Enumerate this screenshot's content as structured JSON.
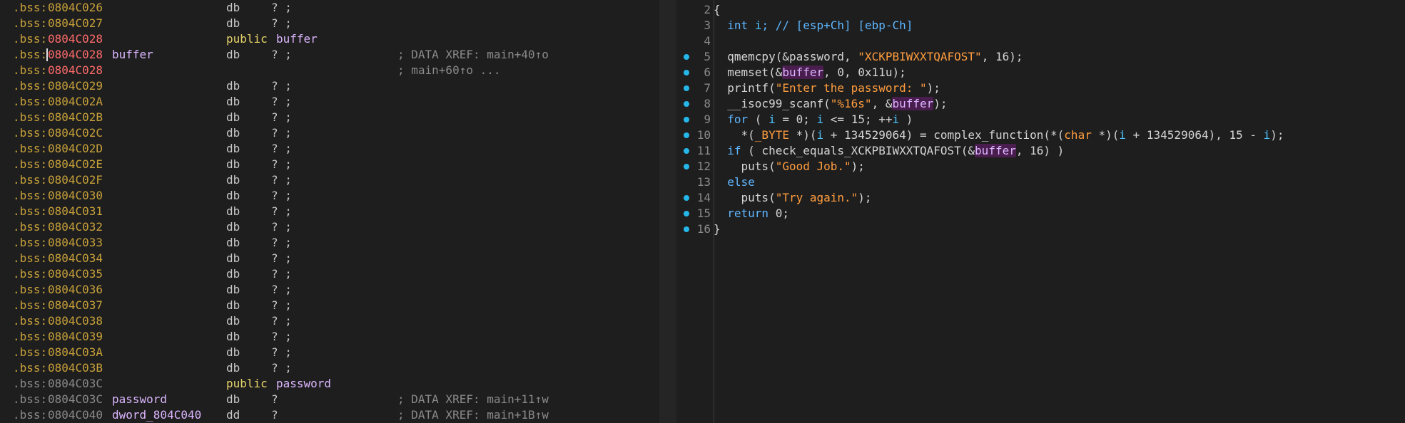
{
  "ida_view": {
    "lines": [
      {
        "seg": ".bss:",
        "addr": "0804C026",
        "label": "",
        "mnem": "db",
        "operand": "? ;",
        "comment": "",
        "addr_style": "normal"
      },
      {
        "seg": ".bss:",
        "addr": "0804C027",
        "label": "",
        "mnem": "db",
        "operand": "? ;",
        "comment": "",
        "addr_style": "normal"
      },
      {
        "seg": ".bss:",
        "addr": "0804C028",
        "label": "",
        "mnem": "public",
        "operand": "buffer",
        "comment": "",
        "addr_style": "red"
      },
      {
        "seg": ".bss:",
        "addr": "0804C028",
        "label": "buffer",
        "mnem": "db",
        "operand": "? ;",
        "comment": "; DATA XREF: main+40↑o",
        "addr_style": "red",
        "cursor": true
      },
      {
        "seg": ".bss:",
        "addr": "0804C028",
        "label": "",
        "mnem": "",
        "operand": "",
        "comment": "; main+60↑o ...",
        "addr_style": "red"
      },
      {
        "seg": ".bss:",
        "addr": "0804C029",
        "label": "",
        "mnem": "db",
        "operand": "? ;",
        "comment": "",
        "addr_style": "normal"
      },
      {
        "seg": ".bss:",
        "addr": "0804C02A",
        "label": "",
        "mnem": "db",
        "operand": "? ;",
        "comment": "",
        "addr_style": "normal"
      },
      {
        "seg": ".bss:",
        "addr": "0804C02B",
        "label": "",
        "mnem": "db",
        "operand": "? ;",
        "comment": "",
        "addr_style": "normal"
      },
      {
        "seg": ".bss:",
        "addr": "0804C02C",
        "label": "",
        "mnem": "db",
        "operand": "? ;",
        "comment": "",
        "addr_style": "normal"
      },
      {
        "seg": ".bss:",
        "addr": "0804C02D",
        "label": "",
        "mnem": "db",
        "operand": "? ;",
        "comment": "",
        "addr_style": "normal"
      },
      {
        "seg": ".bss:",
        "addr": "0804C02E",
        "label": "",
        "mnem": "db",
        "operand": "? ;",
        "comment": "",
        "addr_style": "normal"
      },
      {
        "seg": ".bss:",
        "addr": "0804C02F",
        "label": "",
        "mnem": "db",
        "operand": "? ;",
        "comment": "",
        "addr_style": "normal"
      },
      {
        "seg": ".bss:",
        "addr": "0804C030",
        "label": "",
        "mnem": "db",
        "operand": "? ;",
        "comment": "",
        "addr_style": "normal"
      },
      {
        "seg": ".bss:",
        "addr": "0804C031",
        "label": "",
        "mnem": "db",
        "operand": "? ;",
        "comment": "",
        "addr_style": "normal"
      },
      {
        "seg": ".bss:",
        "addr": "0804C032",
        "label": "",
        "mnem": "db",
        "operand": "? ;",
        "comment": "",
        "addr_style": "normal"
      },
      {
        "seg": ".bss:",
        "addr": "0804C033",
        "label": "",
        "mnem": "db",
        "operand": "? ;",
        "comment": "",
        "addr_style": "normal"
      },
      {
        "seg": ".bss:",
        "addr": "0804C034",
        "label": "",
        "mnem": "db",
        "operand": "? ;",
        "comment": "",
        "addr_style": "normal"
      },
      {
        "seg": ".bss:",
        "addr": "0804C035",
        "label": "",
        "mnem": "db",
        "operand": "? ;",
        "comment": "",
        "addr_style": "normal"
      },
      {
        "seg": ".bss:",
        "addr": "0804C036",
        "label": "",
        "mnem": "db",
        "operand": "? ;",
        "comment": "",
        "addr_style": "normal"
      },
      {
        "seg": ".bss:",
        "addr": "0804C037",
        "label": "",
        "mnem": "db",
        "operand": "? ;",
        "comment": "",
        "addr_style": "normal"
      },
      {
        "seg": ".bss:",
        "addr": "0804C038",
        "label": "",
        "mnem": "db",
        "operand": "? ;",
        "comment": "",
        "addr_style": "normal"
      },
      {
        "seg": ".bss:",
        "addr": "0804C039",
        "label": "",
        "mnem": "db",
        "operand": "? ;",
        "comment": "",
        "addr_style": "normal"
      },
      {
        "seg": ".bss:",
        "addr": "0804C03A",
        "label": "",
        "mnem": "db",
        "operand": "? ;",
        "comment": "",
        "addr_style": "normal"
      },
      {
        "seg": ".bss:",
        "addr": "0804C03B",
        "label": "",
        "mnem": "db",
        "operand": "? ;",
        "comment": "",
        "addr_style": "normal"
      },
      {
        "seg": ".bss:",
        "addr": "0804C03C",
        "label": "",
        "mnem": "public",
        "operand": "password",
        "comment": "",
        "addr_style": "dim"
      },
      {
        "seg": ".bss:",
        "addr": "0804C03C",
        "label": "password",
        "mnem": "db",
        "operand": "?",
        "comment": "; DATA XREF: main+11↑w",
        "addr_style": "dim"
      },
      {
        "seg": ".bss:",
        "addr": "0804C040",
        "label": "dword_804C040",
        "mnem": "dd",
        "operand": "?",
        "comment": "; DATA XREF: main+1B↑w",
        "addr_style": "dim"
      }
    ]
  },
  "pseudocode": {
    "lines": [
      {
        "num": "2",
        "dot": false,
        "tokens": [
          [
            "{",
            "plain"
          ]
        ]
      },
      {
        "num": "3",
        "dot": false,
        "tokens": [
          [
            "  ",
            "plain"
          ],
          [
            "int",
            "kw"
          ],
          [
            " ",
            "plain"
          ],
          [
            "i",
            "var"
          ],
          [
            "; // [esp+Ch] [ebp-Ch]",
            "cmt"
          ]
        ]
      },
      {
        "num": "4",
        "dot": false,
        "tokens": [
          [
            "",
            "plain"
          ]
        ]
      },
      {
        "num": "5",
        "dot": true,
        "tokens": [
          [
            "  qmemcpy(&password, ",
            "plain"
          ],
          [
            "\"XCKPBIWXXTQAFOST\"",
            "str"
          ],
          [
            ", 16);",
            "plain"
          ]
        ]
      },
      {
        "num": "6",
        "dot": true,
        "tokens": [
          [
            "  memset(&",
            "plain"
          ],
          [
            "buffer",
            "buf"
          ],
          [
            ", 0, 0x11u);",
            "plain"
          ]
        ]
      },
      {
        "num": "7",
        "dot": true,
        "tokens": [
          [
            "  printf(",
            "plain"
          ],
          [
            "\"Enter the password: \"",
            "str"
          ],
          [
            ");",
            "plain"
          ]
        ]
      },
      {
        "num": "8",
        "dot": true,
        "tokens": [
          [
            "  __isoc99_scanf(",
            "plain"
          ],
          [
            "\"%16s\"",
            "str"
          ],
          [
            ", &",
            "plain"
          ],
          [
            "buffer",
            "buf"
          ],
          [
            ");",
            "plain"
          ]
        ]
      },
      {
        "num": "9",
        "dot": true,
        "tokens": [
          [
            "  ",
            "plain"
          ],
          [
            "for",
            "kw"
          ],
          [
            " ( ",
            "plain"
          ],
          [
            "i",
            "var"
          ],
          [
            " = 0; ",
            "plain"
          ],
          [
            "i",
            "var"
          ],
          [
            " <= 15; ++",
            "plain"
          ],
          [
            "i",
            "var"
          ],
          [
            " )",
            "plain"
          ]
        ]
      },
      {
        "num": "10",
        "dot": true,
        "tokens": [
          [
            "    *(",
            "plain"
          ],
          [
            "_BYTE",
            "type"
          ],
          [
            " *)(",
            "plain"
          ],
          [
            "i",
            "var"
          ],
          [
            " + 134529064) = complex_function(*(",
            "plain"
          ],
          [
            "char",
            "type"
          ],
          [
            " *)(",
            "plain"
          ],
          [
            "i",
            "var"
          ],
          [
            " + 134529064), 15 - ",
            "plain"
          ],
          [
            "i",
            "var"
          ],
          [
            ");",
            "plain"
          ]
        ]
      },
      {
        "num": "11",
        "dot": true,
        "tokens": [
          [
            "  ",
            "plain"
          ],
          [
            "if",
            "kw"
          ],
          [
            " ( check_equals_XCKPBIWXXTQAFOST(&",
            "plain"
          ],
          [
            "buffer",
            "buf"
          ],
          [
            ", 16) )",
            "plain"
          ]
        ]
      },
      {
        "num": "12",
        "dot": true,
        "tokens": [
          [
            "    puts(",
            "plain"
          ],
          [
            "\"Good Job.\"",
            "str"
          ],
          [
            ");",
            "plain"
          ]
        ]
      },
      {
        "num": "13",
        "dot": false,
        "tokens": [
          [
            "  ",
            "plain"
          ],
          [
            "else",
            "kw"
          ]
        ]
      },
      {
        "num": "14",
        "dot": true,
        "tokens": [
          [
            "    puts(",
            "plain"
          ],
          [
            "\"Try again.\"",
            "str"
          ],
          [
            ");",
            "plain"
          ]
        ]
      },
      {
        "num": "15",
        "dot": true,
        "tokens": [
          [
            "  ",
            "plain"
          ],
          [
            "return",
            "kw"
          ],
          [
            " 0;",
            "plain"
          ]
        ]
      },
      {
        "num": "16",
        "dot": true,
        "tokens": [
          [
            "}",
            "plain"
          ]
        ]
      }
    ]
  }
}
